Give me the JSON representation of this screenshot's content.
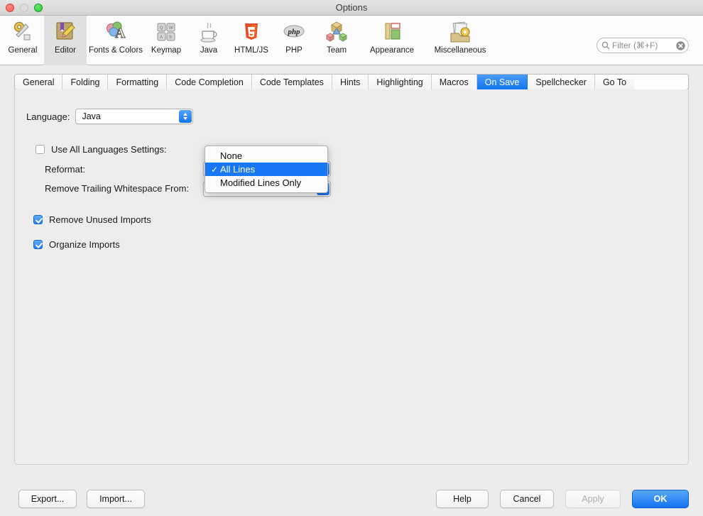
{
  "window": {
    "title": "Options",
    "traffic_lights": [
      "close",
      "minimize",
      "zoom"
    ]
  },
  "toolbar": {
    "items": [
      {
        "label": "General",
        "icon": "general-gear-wrench-icon",
        "selected": false
      },
      {
        "label": "Editor",
        "icon": "editor-book-pencil-icon",
        "selected": true
      },
      {
        "label": "Fonts & Colors",
        "icon": "fonts-colors-icon",
        "selected": false
      },
      {
        "label": "Keymap",
        "icon": "keymap-keys-icon",
        "selected": false
      },
      {
        "label": "Java",
        "icon": "java-coffee-cup-icon",
        "selected": false
      },
      {
        "label": "HTML/JS",
        "icon": "html5-shield-icon",
        "selected": false
      },
      {
        "label": "PHP",
        "icon": "php-elephant-icon",
        "selected": false
      },
      {
        "label": "Team",
        "icon": "team-cubes-icon",
        "selected": false
      },
      {
        "label": "Appearance",
        "icon": "appearance-layout-icon",
        "selected": false
      },
      {
        "label": "Miscellaneous",
        "icon": "miscellaneous-papers-gear-icon",
        "selected": false
      }
    ],
    "filter": {
      "placeholder": "Filter (⌘+F)",
      "value": "",
      "search_icon": "search-icon",
      "clear_icon": "clear-circle-icon"
    }
  },
  "tabs": [
    {
      "label": "General",
      "active": false
    },
    {
      "label": "Folding",
      "active": false
    },
    {
      "label": "Formatting",
      "active": false
    },
    {
      "label": "Code Completion",
      "active": false
    },
    {
      "label": "Code Templates",
      "active": false
    },
    {
      "label": "Hints",
      "active": false
    },
    {
      "label": "Highlighting",
      "active": false
    },
    {
      "label": "Macros",
      "active": false
    },
    {
      "label": "On Save",
      "active": true
    },
    {
      "label": "Spellchecker",
      "active": false
    },
    {
      "label": "Go To",
      "active": false
    }
  ],
  "content": {
    "language_label": "Language:",
    "language_value": "Java",
    "use_all_languages": {
      "label": "Use All Languages Settings:",
      "checked": false
    },
    "reformat_label": "Reformat:",
    "reformat_value": "All Lines",
    "remove_trailing_label": "Remove Trailing Whitespace From:",
    "remove_trailing_value": "All Lines",
    "remove_unused_imports": {
      "label": "Remove Unused Imports",
      "checked": true
    },
    "organize_imports": {
      "label": "Organize Imports",
      "checked": true
    }
  },
  "popup": {
    "items": [
      {
        "label": "None",
        "checked": false,
        "selected": false
      },
      {
        "label": "All Lines",
        "checked": true,
        "selected": true
      },
      {
        "label": "Modified Lines Only",
        "checked": false,
        "selected": false
      }
    ],
    "check_glyph": "✓"
  },
  "footer": {
    "export_label": "Export...",
    "import_label": "Import...",
    "help_label": "Help",
    "cancel_label": "Cancel",
    "apply_label": "Apply",
    "apply_enabled": false,
    "ok_label": "OK"
  },
  "colors": {
    "accent": "#1877f2",
    "window_bg": "#ececec",
    "panel_bg": "#ededed"
  }
}
